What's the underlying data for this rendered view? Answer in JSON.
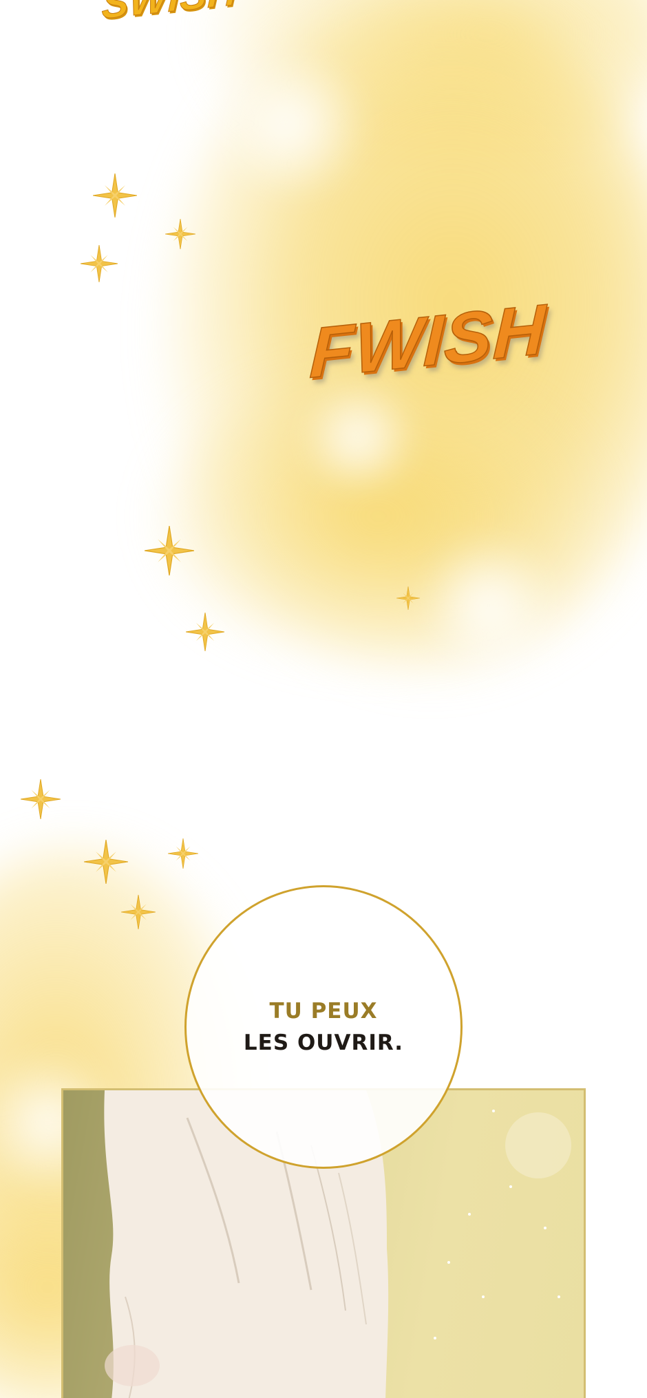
{
  "sound_effects": {
    "top": "SWISH",
    "middle": "FWISH"
  },
  "speech_bubble": {
    "line1": "TU PEUX",
    "line2": "LES OUVRIR."
  },
  "colors": {
    "glow": "#f7d668",
    "sfx_orange": "#ef8a1e",
    "sfx_yellow": "#f2b31c",
    "bubble_border": "#cfa22d",
    "panel_border": "#d3be72"
  }
}
